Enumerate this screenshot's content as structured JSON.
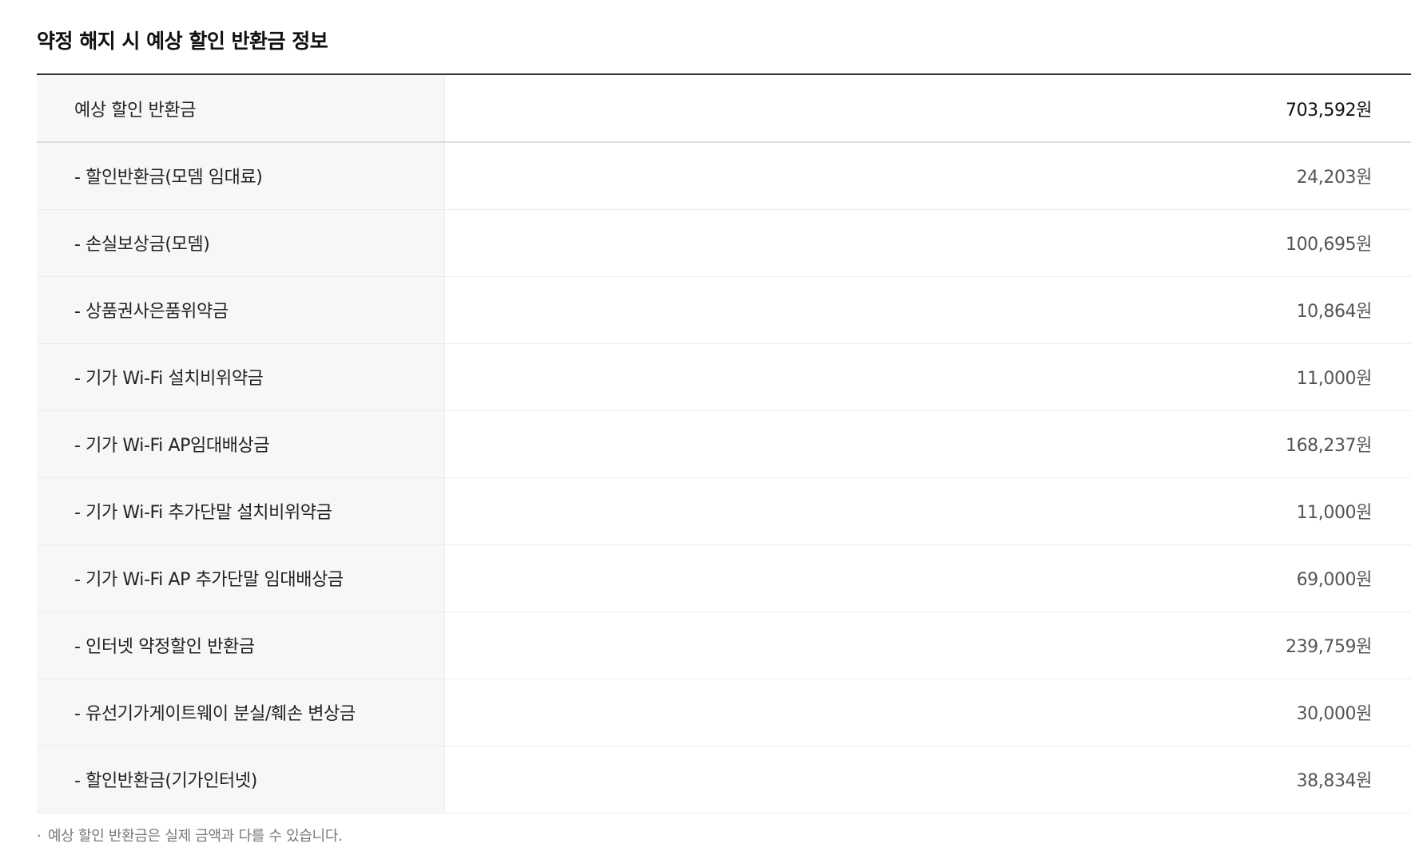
{
  "section": {
    "title": "약정 해지 시 예상 할인 반환금 정보"
  },
  "summary": {
    "label": "예상 할인 반환금",
    "value": "703,592원"
  },
  "rows": [
    {
      "label": "- 할인반환금(모뎀 임대료)",
      "value": "24,203원"
    },
    {
      "label": "- 손실보상금(모뎀)",
      "value": "100,695원"
    },
    {
      "label": "- 상품권사은품위약금",
      "value": "10,864원"
    },
    {
      "label": "- 기가 Wi-Fi 설치비위약금",
      "value": "11,000원"
    },
    {
      "label": "- 기가 Wi-Fi AP임대배상금",
      "value": "168,237원"
    },
    {
      "label": "- 기가 Wi-Fi 추가단말 설치비위약금",
      "value": "11,000원"
    },
    {
      "label": "- 기가 Wi-Fi AP 추가단말 임대배상금",
      "value": "69,000원"
    },
    {
      "label": "- 인터넷 약정할인 반환금",
      "value": "239,759원"
    },
    {
      "label": "- 유선기가게이트웨이 분실/훼손 변상금",
      "value": "30,000원"
    },
    {
      "label": "- 할인반환금(기가인터넷)",
      "value": "38,834원"
    }
  ],
  "notice": {
    "bullet": "·",
    "text": "예상 할인 반환금은 실제 금액과 다를 수 있습니다."
  }
}
